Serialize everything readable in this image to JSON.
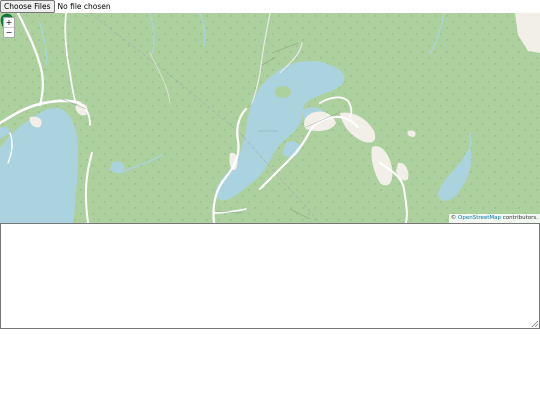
{
  "file_input": {
    "button_label": "Choose Files",
    "status": "No file chosen"
  },
  "map": {
    "zoom_in_label": "+",
    "zoom_out_label": "−",
    "attribution": {
      "prefix": "© ",
      "link_text": "OpenStreetMap",
      "suffix": " contributors."
    },
    "marker_icon": "castle-marker-icon",
    "colors": {
      "land": "#add19e",
      "water": "#aad3df",
      "road": "#ffffff",
      "developed": "#f2efe9",
      "marker": "#0f7a3a"
    }
  },
  "output_textarea": {
    "value": ""
  }
}
